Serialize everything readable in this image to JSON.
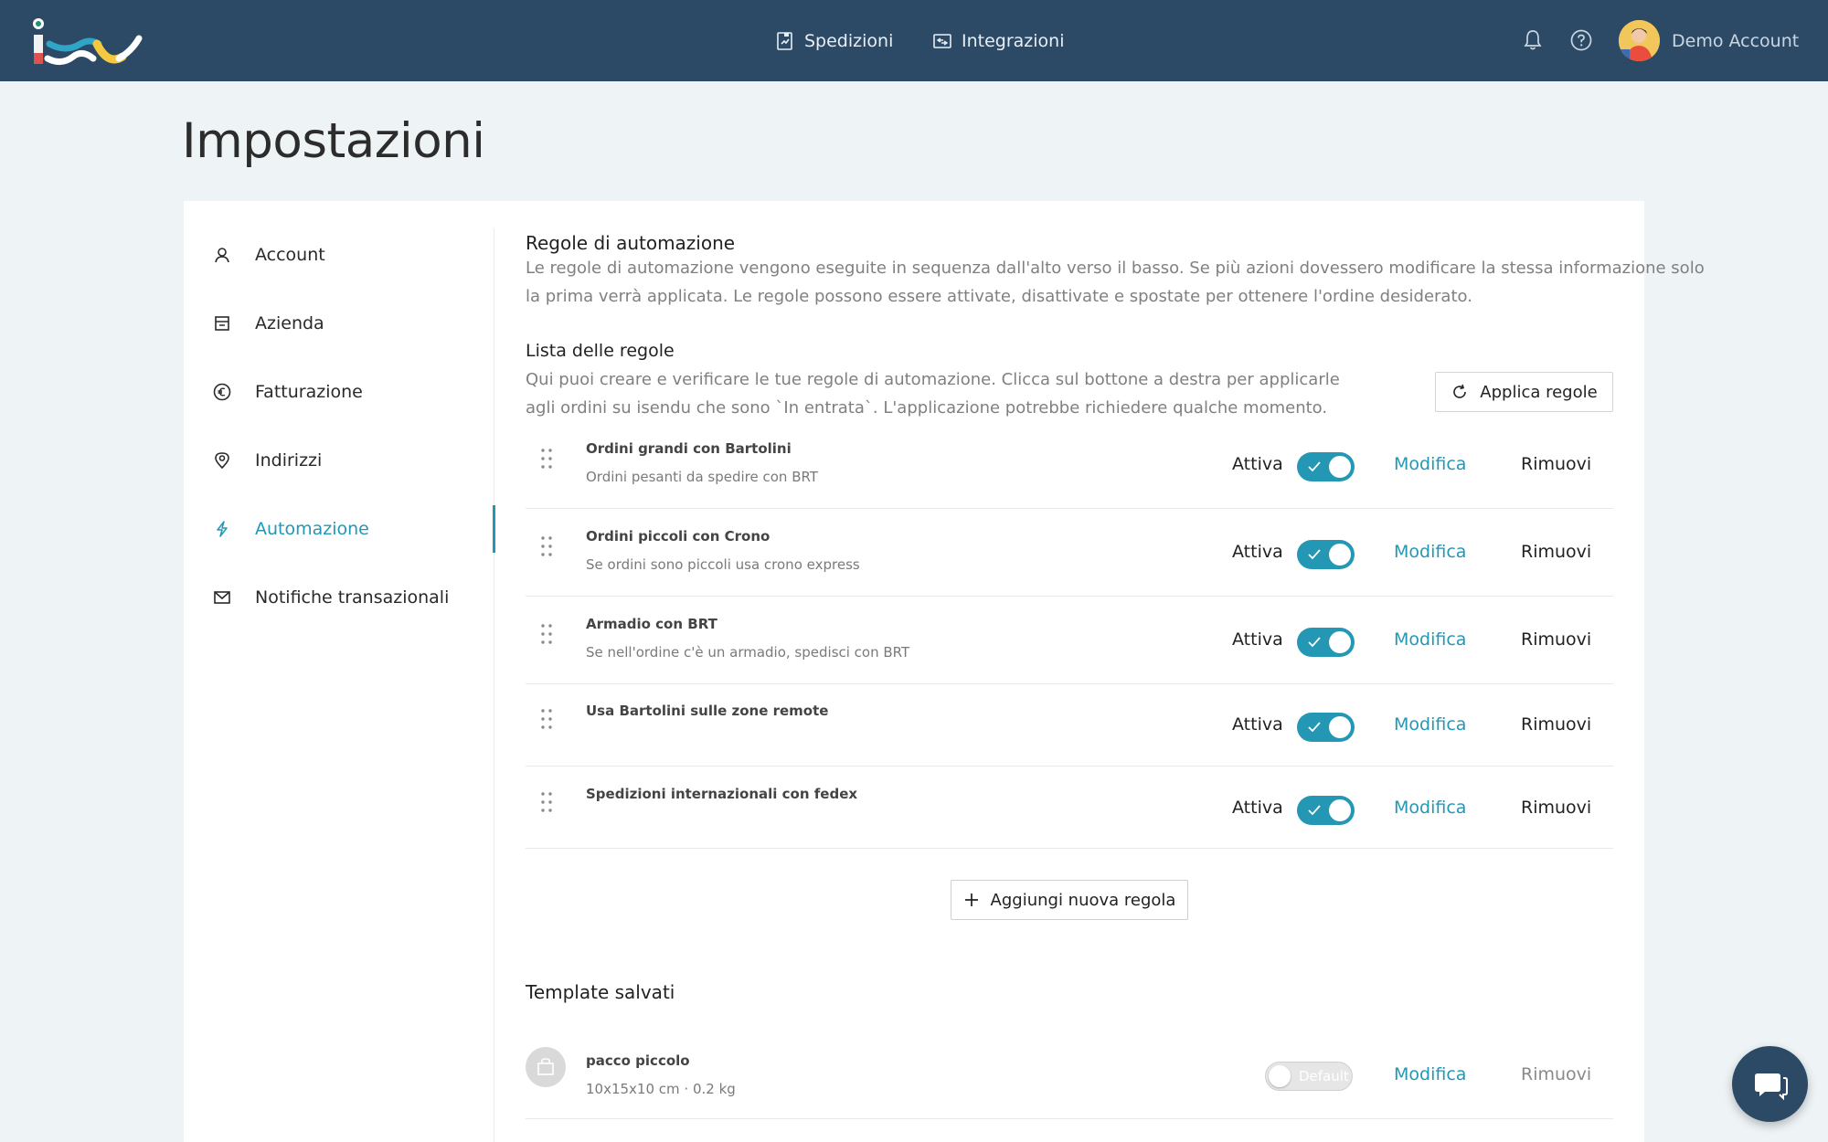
{
  "header": {
    "nav": [
      {
        "label": "Spedizioni",
        "icon": "shipments-icon"
      },
      {
        "label": "Integrazioni",
        "icon": "integrations-icon"
      }
    ],
    "account_name": "Demo Account"
  },
  "page": {
    "title": "Impostazioni"
  },
  "sidebar": {
    "items": [
      {
        "label": "Account",
        "icon": "user-icon",
        "active": false
      },
      {
        "label": "Azienda",
        "icon": "store-icon",
        "active": false
      },
      {
        "label": "Fatturazione",
        "icon": "euro-icon",
        "active": false
      },
      {
        "label": "Indirizzi",
        "icon": "location-pin-icon",
        "active": false
      },
      {
        "label": "Automazione",
        "icon": "lightning-icon",
        "active": true
      },
      {
        "label": "Notifiche transazionali",
        "icon": "mail-icon",
        "active": false
      }
    ]
  },
  "automation": {
    "title": "Regole di automazione",
    "desc_line1": "Le regole di automazione vengono eseguite in sequenza dall'alto verso il basso. Se più azioni dovessero modificare la stessa informazione solo",
    "desc_line2": "la prima verrà applicata. Le regole possono essere attivate, disattivate e spostate per ottenere l'ordine desiderato.",
    "list_title": "Lista delle regole",
    "list_desc_line1": "Qui puoi creare e verificare le tue regole di automazione. Clicca sul bottone a destra per applicarle",
    "list_desc_line2": "agli ordini su isendu che sono `In entrata`. L'applicazione potrebbe richiedere qualche momento.",
    "apply_label": "Applica regole",
    "add_label": "Aggiungi nuova regola",
    "rules": [
      {
        "name": "Ordini grandi con Bartolini",
        "description": "Ordini pesanti da spedire con BRT",
        "status": "Attiva",
        "enabled": true,
        "edit": "Modifica",
        "remove": "Rimuovi"
      },
      {
        "name": "Ordini piccoli con Crono",
        "description": "Se ordini sono piccoli usa crono express",
        "status": "Attiva",
        "enabled": true,
        "edit": "Modifica",
        "remove": "Rimuovi"
      },
      {
        "name": "Armadio con BRT",
        "description": "Se nell'ordine c'è un armadio, spedisci con BRT",
        "status": "Attiva",
        "enabled": true,
        "edit": "Modifica",
        "remove": "Rimuovi"
      },
      {
        "name": "Usa Bartolini sulle zone remote",
        "description": "",
        "status": "Attiva",
        "enabled": true,
        "edit": "Modifica",
        "remove": "Rimuovi"
      },
      {
        "name": "Spedizioni internazionali con fedex",
        "description": "",
        "status": "Attiva",
        "enabled": true,
        "edit": "Modifica",
        "remove": "Rimuovi"
      }
    ]
  },
  "templates": {
    "title": "Template salvati",
    "items": [
      {
        "name": "pacco piccolo",
        "details": "10x15x10 cm · 0.2 kg",
        "default_label": "Default",
        "is_default": false,
        "edit": "Modifica",
        "remove": "Rimuovi"
      }
    ]
  },
  "colors": {
    "header_bg": "#2c4a66",
    "accent": "#2397b4",
    "page_bg": "#eef3f6"
  }
}
